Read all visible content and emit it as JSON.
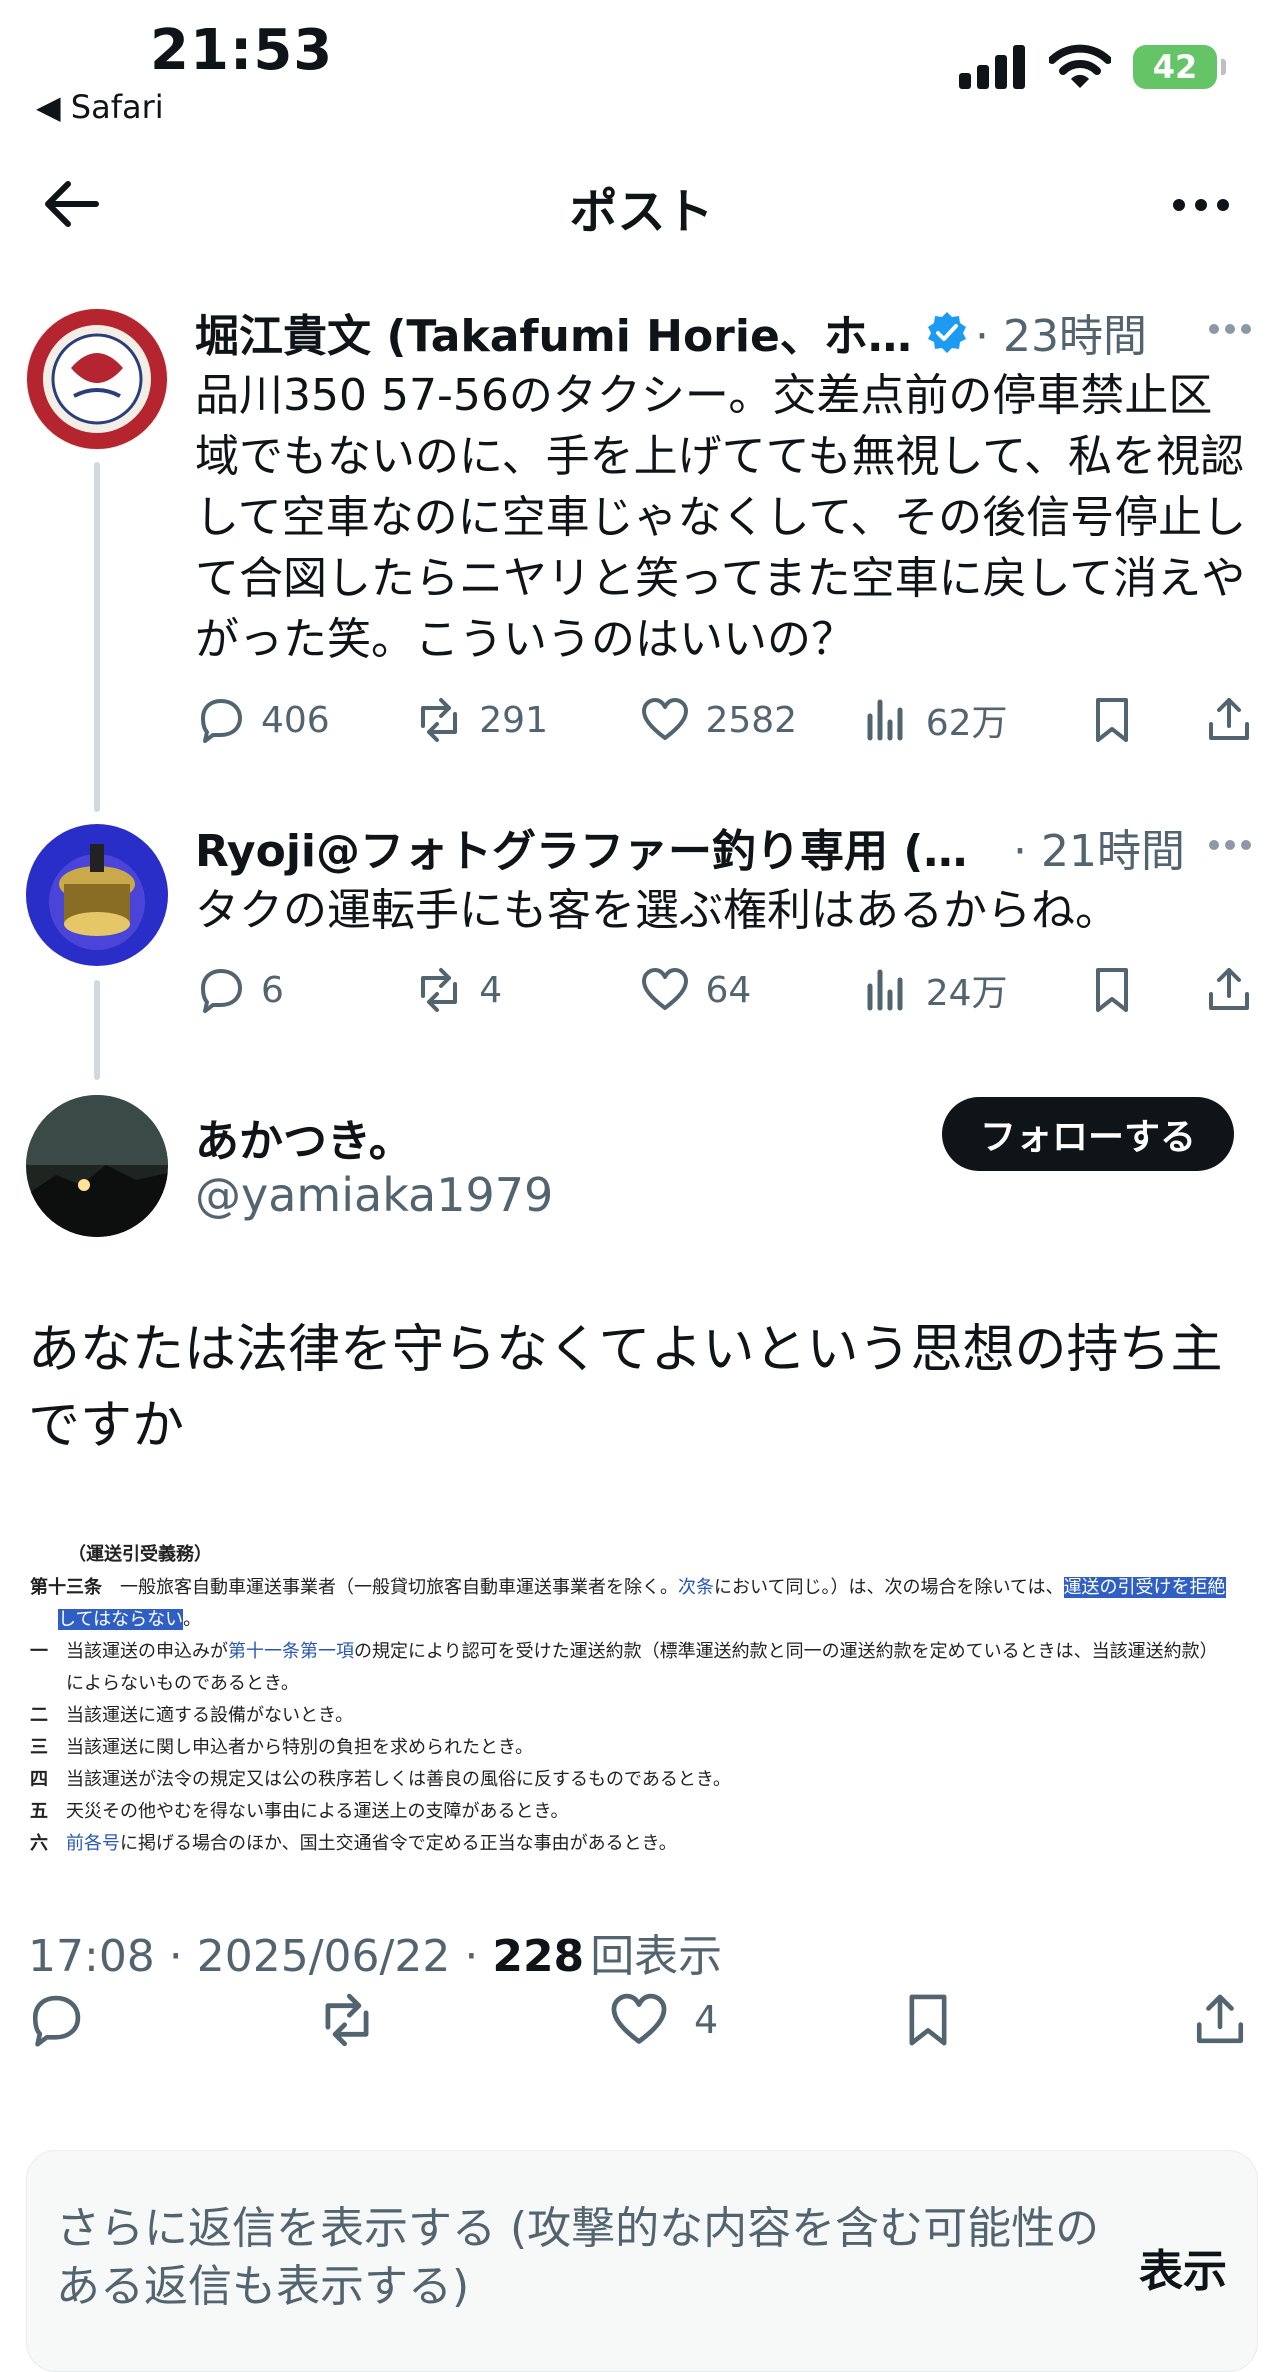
{
  "status_bar": {
    "time": "21:53",
    "back_app": "◀ Safari",
    "battery": "42"
  },
  "header": {
    "title": "ポスト"
  },
  "tweets": [
    {
      "name": "堀江貴文 (Takafumi Horie、ホリ...",
      "time": "· 23時間",
      "text": "品川350 57-56のタクシー。交差点前の停車禁止区域でもないのに、手を上げてても無視して、私を視認して空車なのに空車じゃなくして、その後信号停止して合図したらニヤリと笑ってまた空車に戻して消えやがった笑。こういうのはいいの？",
      "replies": "406",
      "reposts": "291",
      "likes": "2582",
      "views": "62万"
    },
    {
      "name": "Ryoji@フォトグラファー釣り専用 (緊...",
      "time": "· 21時間",
      "text": "タクの運転手にも客を選ぶ権利はあるからね。",
      "replies": "6",
      "reposts": "4",
      "likes": "64",
      "views": "24万"
    }
  ],
  "main_tweet": {
    "name": "あかつき。",
    "handle": "@yamiaka1979",
    "follow_label": "フォローする",
    "text": "あなたは法律を守らなくてよいという思想の持ち主ですか",
    "timestamp": "17:08 · 2025/06/22 · ",
    "views_count": "228",
    "views_label": "回表示",
    "likes": "4"
  },
  "law_image": {
    "heading": "（運送引受義務）",
    "article": "第十三条",
    "body_1": "一般旅客自動車運送事業者（一般貸切旅客自動車運送事業者を除く。",
    "link_1": "次条",
    "body_2": "において同じ。）は、次の場合を除いては、",
    "highlight_1": "運送の引受けを拒絶",
    "highlight_2": "してはならない",
    "body_3": "。",
    "items": [
      {
        "num": "一",
        "pre": "当該運送の申込みが",
        "link": "第十一条第一項",
        "post": "の規定により認可を受けた運送約款（標準運送約款と同一の運送約款を定めているときは、当該運送約款）",
        "cont": "によらないものであるとき。"
      },
      {
        "num": "二",
        "pre": "当該運送に適する設備がないとき。",
        "link": "",
        "post": "",
        "cont": ""
      },
      {
        "num": "三",
        "pre": "当該運送に関し申込者から特別の負担を求められたとき。",
        "link": "",
        "post": "",
        "cont": ""
      },
      {
        "num": "四",
        "pre": "当該運送が法令の規定又は公の秩序若しくは善良の風俗に反するものであるとき。",
        "link": "",
        "post": "",
        "cont": ""
      },
      {
        "num": "五",
        "pre": "天災その他やむを得ない事由による運送上の支障があるとき。",
        "link": "",
        "post": "",
        "cont": ""
      },
      {
        "num": "六",
        "pre": "",
        "link": "前各号",
        "post": "に掲げる場合のほか、国土交通省令で定める正当な事由があるとき。",
        "cont": ""
      }
    ]
  },
  "more_replies": {
    "text": "さらに返信を表示する (攻撃的な内容を含む可能性のある返信も表示する)",
    "button": "表示"
  },
  "colors": {
    "text": "#0f1419",
    "secondary": "#536471",
    "verified": "#1d9bf0",
    "battery": "#65c466"
  }
}
